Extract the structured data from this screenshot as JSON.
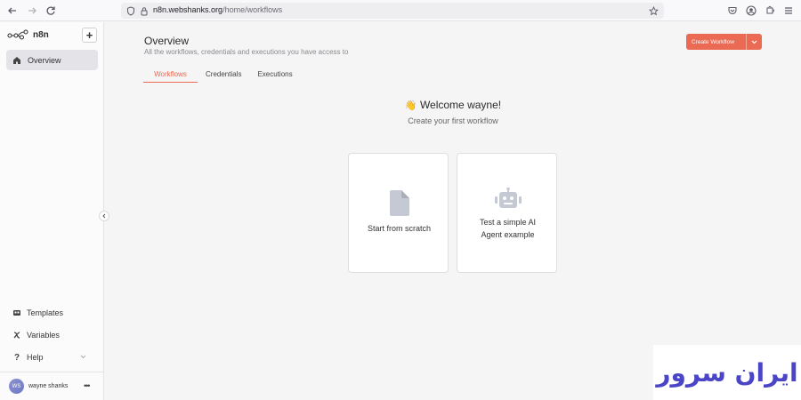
{
  "browser": {
    "url_host": "n8n.webshanks.org",
    "url_path": "/home/workflows"
  },
  "sidebar": {
    "app_name": "n8n",
    "add_label": "+",
    "overview_label": "Overview",
    "items": [
      {
        "label": "Templates",
        "icon": "templates-icon"
      },
      {
        "label": "Variables",
        "icon": "variables-icon"
      },
      {
        "label": "Help",
        "icon": "help-icon"
      }
    ],
    "user": {
      "initials": "WS",
      "name": "wayne shanks",
      "menu": "•••"
    }
  },
  "header": {
    "title": "Overview",
    "subtitle": "All the workflows, credentials and executions you have access to",
    "create_label": "Create Workflow"
  },
  "tabs": [
    {
      "label": "Workflows",
      "active": true
    },
    {
      "label": "Credentials",
      "active": false
    },
    {
      "label": "Executions",
      "active": false
    }
  ],
  "welcome": {
    "emoji": "👋",
    "title": "Welcome wayne!",
    "subtitle": "Create your first workflow"
  },
  "cards": [
    {
      "label_line1": "Start from scratch",
      "label_line2": ""
    },
    {
      "label_line1": "Test a simple AI",
      "label_line2": "Agent example"
    }
  ],
  "colors": {
    "accent": "#ea6a54",
    "watermark": "#4a45c6"
  },
  "watermark_text": "ایران سرور"
}
